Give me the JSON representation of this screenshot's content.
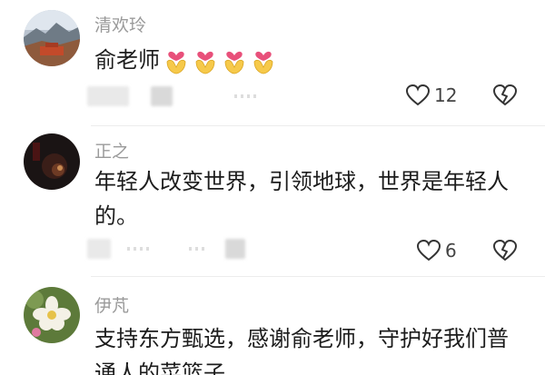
{
  "comments": [
    {
      "username": "清欢玲",
      "text": "俞老师",
      "reaction_icon": "heart-hands-emoji",
      "reaction_repeat": 4,
      "like_count": "12"
    },
    {
      "username": "正之",
      "text": "年轻人改变世界，引领地球，世界是年轻人的。",
      "like_count": "6"
    },
    {
      "username": "伊芃",
      "text": "支持东方甄选，感谢俞老师，守护好我们普通人的菜篮子"
    }
  ],
  "colors": {
    "username": "#9a9a9a",
    "text": "#1c1c1c",
    "icon_stroke": "#333333",
    "divider": "#ececec"
  },
  "icons": {
    "like": "heart-outline-icon",
    "dislike": "broken-heart-outline-icon"
  }
}
